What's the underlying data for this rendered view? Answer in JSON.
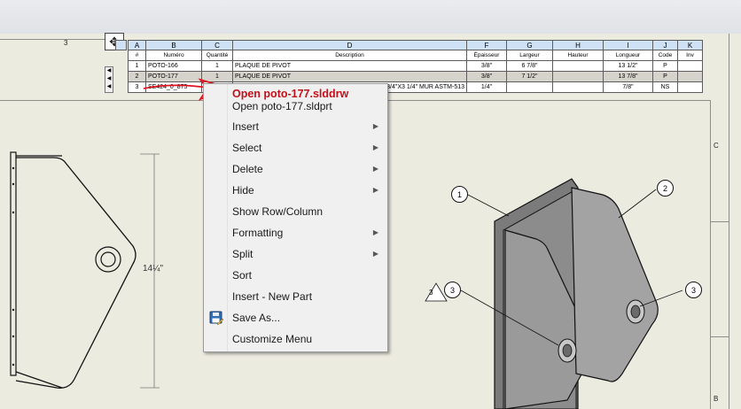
{
  "zone_labels": {
    "top_3": "3",
    "right_c": "C",
    "right_b": "B"
  },
  "bom": {
    "letters": [
      "A",
      "B",
      "C",
      "D",
      "F",
      "G",
      "H",
      "I",
      "J",
      "K"
    ],
    "headers": [
      "#",
      "Numéro",
      "Quantité",
      "Description",
      "Épaisseur",
      "Largeur",
      "Hauteur",
      "Longueur",
      "Code",
      "Inv"
    ],
    "rows": [
      {
        "num": "1",
        "part": "POTO-166",
        "qty": "1",
        "desc": "PLAQUE DE PIVOT",
        "ep": "3/8\"",
        "larg": "6 7/8\"",
        "haut": "",
        "long": "13 1/2\"",
        "code": "P",
        "inv": ""
      },
      {
        "num": "2",
        "part": "POTO-177",
        "qty": "1",
        "desc": "PLAQUE DE PIVOT",
        "ep": "3/8\"",
        "larg": "7 1/2\"",
        "haut": "",
        "long": "13 7/8\"",
        "code": "P",
        "inv": ""
      },
      {
        "num": "3",
        "part": "SE424_0_875",
        "qty": "",
        "desc": "3/4\"X3 1/4\" MUR ASTM-513",
        "ep": "1/4\"",
        "larg": "",
        "haut": "",
        "long": "7/8\"",
        "code": "NS",
        "inv": ""
      }
    ]
  },
  "row_handle_icon": "drag-handle-icon",
  "move_handle_icon": "move-arrows-icon",
  "menu": {
    "items": [
      {
        "label": "Open poto-177.slddrw",
        "submenu": false,
        "highlight": true
      },
      {
        "label": "Open poto-177.sldprt",
        "submenu": false
      },
      {
        "label": "Insert",
        "submenu": true
      },
      {
        "label": "Select",
        "submenu": true
      },
      {
        "label": "Delete",
        "submenu": true
      },
      {
        "label": "Hide",
        "submenu": true
      },
      {
        "label": "Show Row/Column",
        "submenu": false
      },
      {
        "label": "Formatting",
        "submenu": true
      },
      {
        "label": "Split",
        "submenu": true
      },
      {
        "label": "Sort",
        "submenu": false
      },
      {
        "label": "Insert - New Part",
        "submenu": false
      },
      {
        "label": "Save As...",
        "submenu": false,
        "icon": "save-as-icon"
      },
      {
        "label": "Customize Menu",
        "submenu": false
      }
    ],
    "submenu_arrow": "▶"
  },
  "drawing": {
    "dimension": "14¼\"",
    "callouts": [
      "1",
      "2",
      "3",
      "3"
    ],
    "revision_triangle": "3"
  },
  "colors": {
    "highlight_text": "#c4101a",
    "annotation_red": "#e0141e",
    "table_header": "#cfe2f5"
  }
}
